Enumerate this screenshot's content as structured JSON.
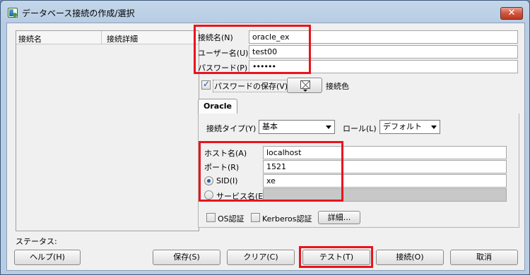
{
  "window": {
    "title": "データベース接続の作成/選択",
    "close_symbol": "✕"
  },
  "connection_list": {
    "columns": [
      "接続名",
      "接続詳細"
    ]
  },
  "form": {
    "connection_name_label": "接続名(N)",
    "connection_name_value": "oracle_ex",
    "username_label": "ユーザー名(U)",
    "username_value": "test00",
    "password_label": "パスワード(P)",
    "password_value": "••••••",
    "save_password_label": "パスワードの保存(V)",
    "save_password_checked": true,
    "connection_color_label": "接続色"
  },
  "oracle_tab": {
    "tab_label": "Oracle",
    "connection_type_label": "接続タイプ(Y)",
    "connection_type_value": "基本",
    "role_label": "ロール(L)",
    "role_value": "デフォルト",
    "host_label": "ホスト名(A)",
    "host_value": "localhost",
    "port_label": "ポート(R)",
    "port_value": "1521",
    "sid_label": "SID(I)",
    "sid_value": "xe",
    "sid_selected": true,
    "service_label": "サービス名(E)",
    "service_value": "",
    "os_auth_label": "OS認証",
    "kerberos_label": "Kerberos認証",
    "advanced_label": "詳細..."
  },
  "status": {
    "label": "ステータス:"
  },
  "buttons": {
    "help": "ヘルプ(H)",
    "save": "保存(S)",
    "clear": "クリア(C)",
    "test": "テスト(T)",
    "connect": "接続(O)",
    "cancel": "取消"
  },
  "colors": {
    "highlight_box": "#e8141e",
    "checkbox_check": "#2050b0"
  }
}
